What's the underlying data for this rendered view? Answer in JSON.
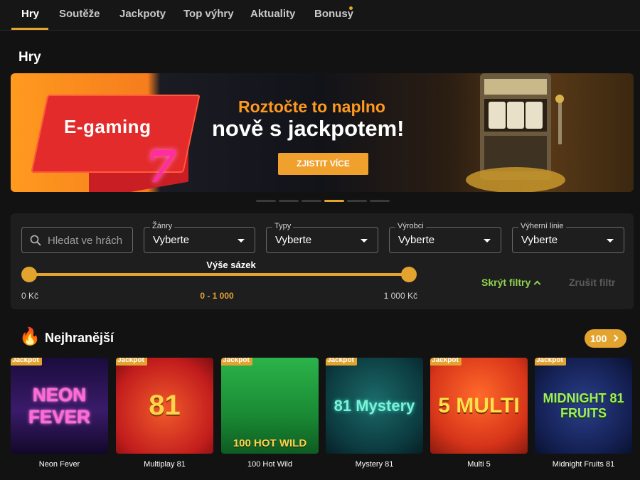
{
  "nav": {
    "tabs": [
      {
        "label": "Hry",
        "active": true
      },
      {
        "label": "Soutěže",
        "active": false
      },
      {
        "label": "Jackpoty",
        "active": false
      },
      {
        "label": "Top výhry",
        "active": false
      },
      {
        "label": "Aktuality",
        "active": false
      },
      {
        "label": "Bonusy",
        "active": false,
        "dot": true
      }
    ]
  },
  "page": {
    "title": "Hry"
  },
  "banner": {
    "brand": "E-gaming",
    "seven": "7",
    "headline1": "Roztočte to naplno",
    "headline2": "nově s jackpotem!",
    "cta": "ZJISTIT VÍCE",
    "slides": 6,
    "active_slide": 4
  },
  "filters": {
    "search_placeholder": "Hledat ve hrách",
    "selects": [
      {
        "label": "Žánry",
        "value": "Vyberte"
      },
      {
        "label": "Typy",
        "value": "Vyberte"
      },
      {
        "label": "Výrobci",
        "value": "Vyberte"
      },
      {
        "label": "Výherní linie",
        "value": "Vyberte"
      }
    ],
    "bet_slider": {
      "title": "Výše sázek",
      "min_label": "0 Kč",
      "max_label": "1 000 Kč",
      "range_label": "0 - 1 000",
      "range_min": 0,
      "range_max": 1000
    },
    "hide_filters": "Skrýt filtry",
    "clear_filter": "Zrušit filtr"
  },
  "section": {
    "icon": "flame-icon",
    "title": "Nejhranější",
    "count": "100"
  },
  "games": [
    {
      "name": "Neon Fever",
      "badge": "Jackpot",
      "art": "NEON FEVER"
    },
    {
      "name": "Multiplay 81",
      "badge": "Jackpot",
      "art": "81"
    },
    {
      "name": "100 Hot Wild",
      "badge": "Jackpot",
      "art": "100 HOT WILD"
    },
    {
      "name": "Mystery 81",
      "badge": "Jackpot",
      "art": "81 Mystery"
    },
    {
      "name": "Multi 5",
      "badge": "Jackpot",
      "art": "5 MULTI"
    },
    {
      "name": "Midnight Fruits 81",
      "badge": "Jackpot",
      "art": "MIDNIGHT 81 FRUITS"
    }
  ],
  "colors": {
    "accent": "#e3a32f",
    "success": "#8fd14f",
    "background": "#121212",
    "panel": "#1e1e1e"
  }
}
